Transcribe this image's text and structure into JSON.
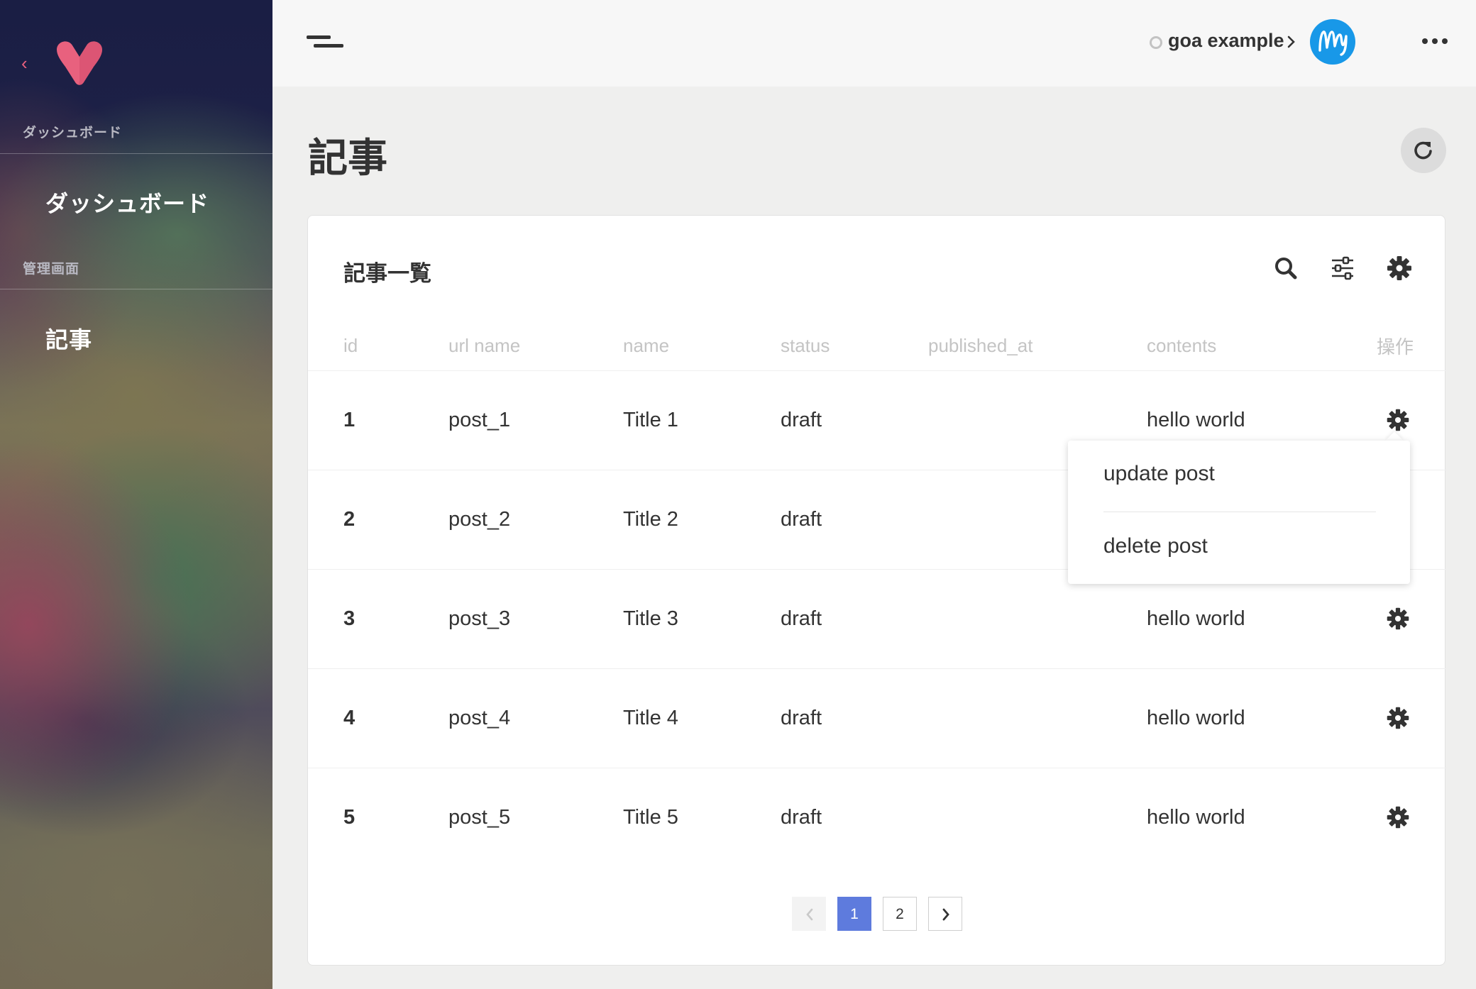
{
  "sidebar": {
    "sections": [
      {
        "heading": "ダッシュボード",
        "items": [
          {
            "label": "ダッシュボード"
          }
        ]
      },
      {
        "heading": "管理画面",
        "items": [
          {
            "label": "記事"
          }
        ]
      }
    ]
  },
  "topbar": {
    "project": "goa example"
  },
  "page": {
    "title": "記事"
  },
  "card": {
    "title": "記事一覧",
    "columns": [
      "id",
      "url name",
      "name",
      "status",
      "published_at",
      "contents",
      "操作"
    ],
    "rows": [
      {
        "id": "1",
        "url_name": "post_1",
        "name": "Title 1",
        "status": "draft",
        "published_at": "",
        "contents": "hello world"
      },
      {
        "id": "2",
        "url_name": "post_2",
        "name": "Title 2",
        "status": "draft",
        "published_at": "",
        "contents": ""
      },
      {
        "id": "3",
        "url_name": "post_3",
        "name": "Title 3",
        "status": "draft",
        "published_at": "",
        "contents": "hello world"
      },
      {
        "id": "4",
        "url_name": "post_4",
        "name": "Title 4",
        "status": "draft",
        "published_at": "",
        "contents": "hello world"
      },
      {
        "id": "5",
        "url_name": "post_5",
        "name": "Title 5",
        "status": "draft",
        "published_at": "",
        "contents": "hello world"
      }
    ]
  },
  "dropdown": {
    "items": [
      "update post",
      "delete post"
    ]
  },
  "pagination": {
    "pages": [
      "1",
      "2"
    ],
    "current": "1"
  },
  "colors": {
    "accent": "#5e7bdd",
    "logo": "#e8617e",
    "avatar": "#1898e8"
  }
}
